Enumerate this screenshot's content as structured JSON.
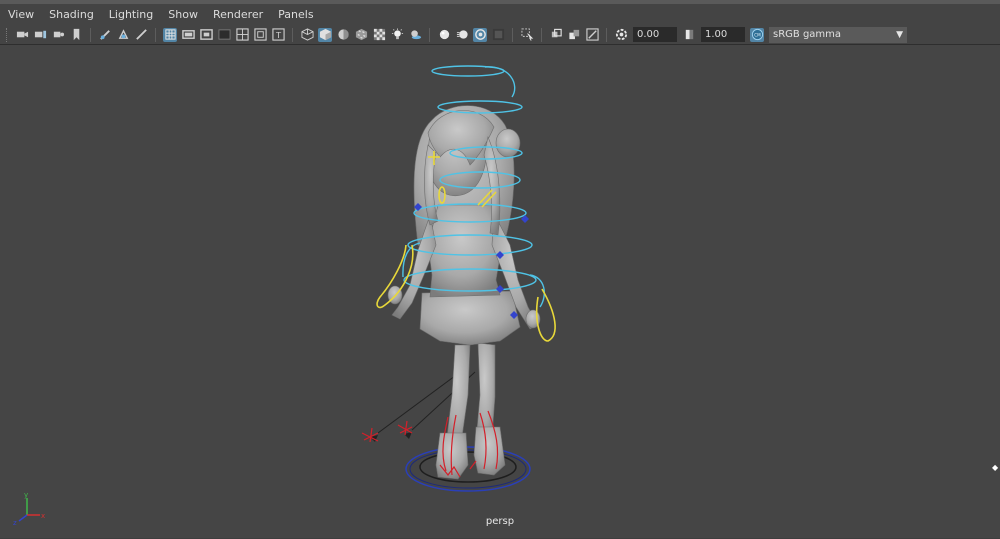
{
  "menu": [
    "View",
    "Shading",
    "Lighting",
    "Show",
    "Renderer",
    "Panels"
  ],
  "toolbar": {
    "exposure_value": "0.00",
    "gamma_value": "1.00",
    "color_space": "sRGB gamma",
    "icons": [
      "camera-icon",
      "camera-attributes-icon",
      "bookmark-icon",
      "image-plane-icon",
      "grease-pencil-icon",
      "2d-pan-zoom-icon",
      "grid-icon",
      "film-gate-icon",
      "resolution-gate-icon",
      "gate-mask-icon",
      "field-chart-icon",
      "safe-action-icon",
      "safe-title-icon",
      "wireframe-icon",
      "smooth-shade-icon",
      "flat-shade-icon",
      "bounding-box-icon",
      "textured-icon",
      "lights-icon",
      "shadows-icon",
      "screen-space-ao-icon",
      "motion-blur-icon",
      "anti-aliasing-icon",
      "depth-of-field-icon",
      "isolate-select-icon",
      "x-ray-icon",
      "x-ray-joints-icon",
      "backface-culling-icon",
      "exposure-icon",
      "gamma-icon",
      "color-management-icon"
    ]
  },
  "viewport": {
    "camera_label": "persp"
  },
  "colors": {
    "background": "#454545",
    "control_blue": "#4fc3e6",
    "control_yellow": "#e8d83a",
    "ik_red": "#d4202a",
    "joint_blue": "#3344cc"
  }
}
